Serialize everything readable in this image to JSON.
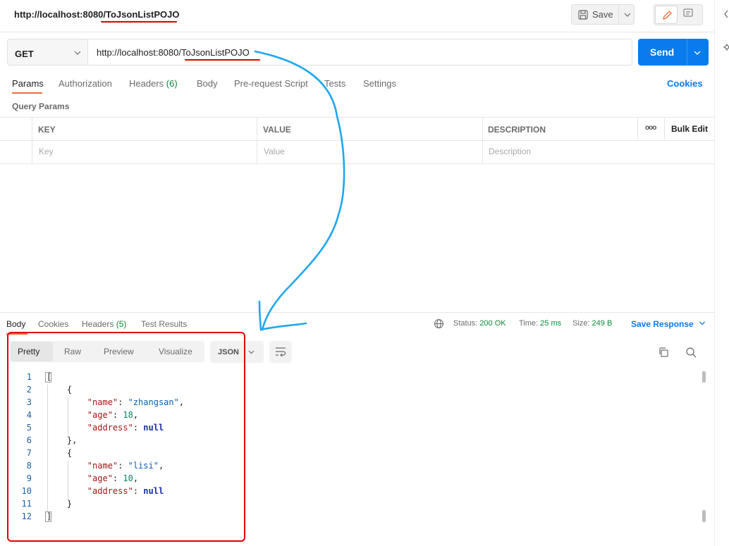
{
  "header": {
    "title": "http://localhost:8080/ToJsonListPOJO",
    "save_label": "Save"
  },
  "request": {
    "method": "GET",
    "url": "http://localhost:8080/ToJsonListPOJO",
    "send_label": "Send"
  },
  "request_tabs": [
    {
      "label": "Params"
    },
    {
      "label": "Authorization"
    },
    {
      "label": "Headers",
      "count": "(6)"
    },
    {
      "label": "Body"
    },
    {
      "label": "Pre-request Script"
    },
    {
      "label": "Tests"
    },
    {
      "label": "Settings"
    }
  ],
  "cookies_link": "Cookies",
  "query_params": {
    "title": "Query Params",
    "columns": [
      "KEY",
      "VALUE",
      "DESCRIPTION"
    ],
    "placeholders": [
      "Key",
      "Value",
      "Description"
    ],
    "more": "ooo",
    "bulk_edit": "Bulk Edit"
  },
  "response": {
    "tabs": [
      {
        "label": "Body"
      },
      {
        "label": "Cookies"
      },
      {
        "label": "Headers",
        "count": "(5)"
      },
      {
        "label": "Test Results"
      }
    ],
    "status_label": "Status:",
    "status_value": "200 OK",
    "time_label": "Time:",
    "time_value": "25 ms",
    "size_label": "Size:",
    "size_value": "249 B",
    "save_response": "Save Response",
    "view_tabs": [
      "Pretty",
      "Raw",
      "Preview",
      "Visualize"
    ],
    "format": "JSON",
    "line_numbers": [
      "1",
      "2",
      "3",
      "4",
      "5",
      "6",
      "7",
      "8",
      "9",
      "10",
      "11",
      "12"
    ]
  },
  "json_body": [
    {
      "name": "zhangsan",
      "age": 18,
      "address": null
    },
    {
      "name": "lisi",
      "age": 10,
      "address": null
    }
  ],
  "annotation": {
    "color": "#e00000",
    "arrow_color": "#1ea7f0"
  }
}
